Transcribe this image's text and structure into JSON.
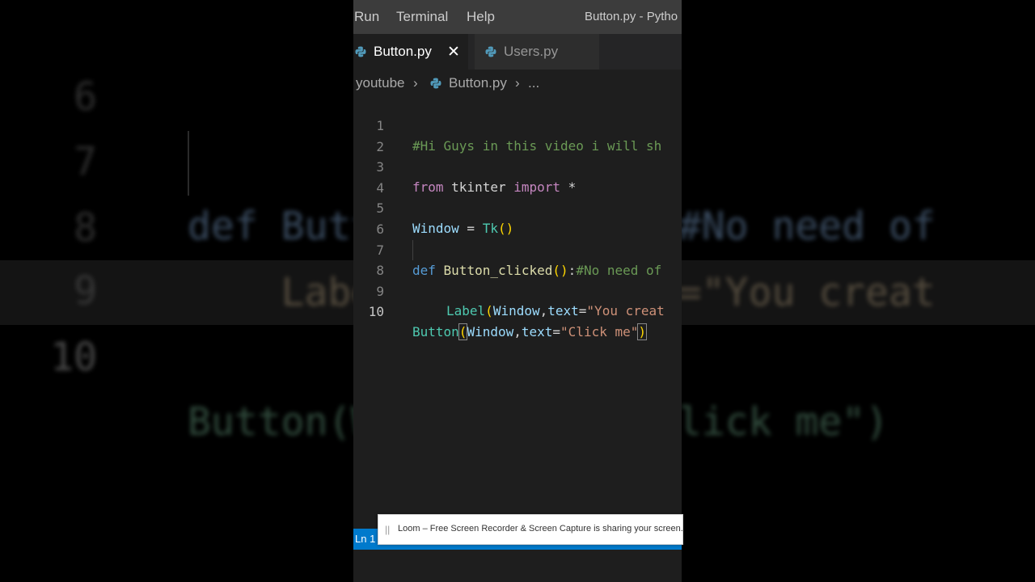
{
  "background": {
    "lines": [
      {
        "num": "6",
        "code": ""
      },
      {
        "num": "7",
        "code": "def Button_clicked():#No need of"
      },
      {
        "num": "8",
        "code": "    Label(Window,text=\"You creat"
      },
      {
        "num": "9",
        "code": ""
      },
      {
        "num": "10",
        "code": "Button(Window,text=\"Click me\")"
      }
    ]
  },
  "menubar": {
    "items": [
      "Run",
      "Terminal",
      "Help"
    ],
    "title": "Button.py - Pytho"
  },
  "tabs": [
    {
      "label": "Button.py",
      "active": true,
      "close": "✕"
    },
    {
      "label": "Users.py",
      "active": false
    }
  ],
  "breadcrumb": {
    "folder": "youtube",
    "sep1": "›",
    "file": "Button.py",
    "sep2": "›",
    "more": "..."
  },
  "editor": {
    "line_numbers": [
      "1",
      "2",
      "3",
      "4",
      "5",
      "6",
      "7",
      "8",
      "9",
      "10"
    ],
    "line1": "#Hi Guys in this video i will sh",
    "line3": {
      "kw1": "from",
      "mod": " tkinter ",
      "kw2": "import",
      "star": " *"
    },
    "line5": {
      "var": "Window",
      "eq": " = ",
      "cls": "Tk",
      "par": "()"
    },
    "line7": {
      "kw": "def",
      "fn": " Button_clicked",
      "par": "()",
      "colon": ":",
      "cmt": "#No need of"
    },
    "line8": {
      "cls": "Label",
      "p1": "(",
      "var": "Window",
      "comma": ",",
      "var2": "text",
      "eq": "=",
      "str": "\"You creat"
    },
    "line10": {
      "cls": "Button",
      "p1": "(",
      "var": "Window",
      "comma": ",",
      "var2": "text",
      "eq": "=",
      "str": "\"Click me\"",
      "p2": ")"
    }
  },
  "statusbar": {
    "position": "Ln 1"
  },
  "loom": {
    "grip": "||",
    "message": "Loom – Free Screen Recorder & Screen Capture is sharing your screen."
  },
  "taskbar": {
    "icons": [
      "task-view-icon",
      "vlc-icon",
      "photos-icon",
      "file-explorer-icon",
      "chrome-icon",
      "notepad-icon",
      "paint-icon",
      "vscode-icon"
    ]
  },
  "colors": {
    "status_bar": "#007acc",
    "editor_bg": "#1e1e1e",
    "comment": "#6a9955",
    "keyword": "#c586c0",
    "string": "#ce9178"
  }
}
